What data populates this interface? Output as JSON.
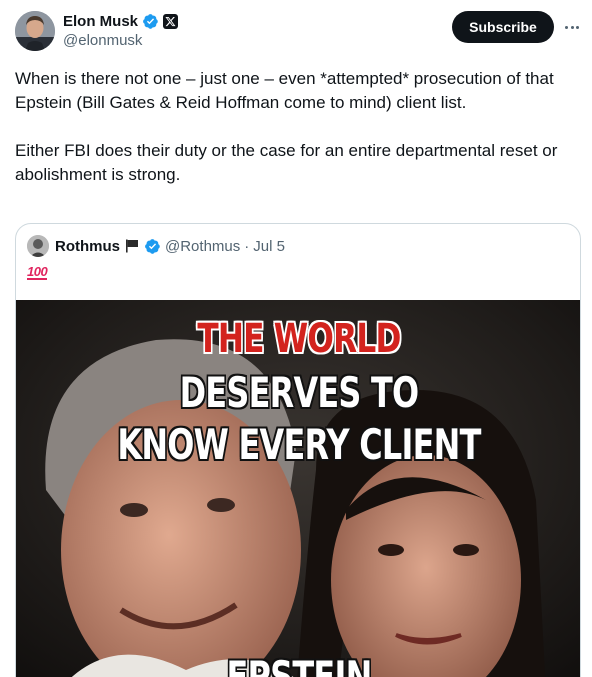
{
  "author": {
    "display_name": "Elon Musk",
    "handle": "@elonmusk",
    "verified_color": "#1d9bf0",
    "avatar_icon": "profile-photo",
    "affiliation_icon": "x-logo-icon"
  },
  "actions": {
    "subscribe_label": "Subscribe",
    "more_icon": "more-horizontal-icon"
  },
  "tweet": {
    "paragraph_1": "When is there not one – just one – even *attempted* prosecution of that Epstein (Bill Gates & Reid Hoffman come to mind) client list.",
    "paragraph_2": "Either FBI does their duty or the case for an entire departmental reset or abolishment is strong."
  },
  "quote": {
    "display_name": "Rothmus",
    "flag_icon": "black-flag-icon",
    "handle": "@Rothmus",
    "separator": "·",
    "date": "Jul 5",
    "emoji_text": "100",
    "emoji_icon": "hundred-points-emoji",
    "media": {
      "line_1": "THE WORLD",
      "line_2": "DESERVES TO",
      "line_3": "KNOW EVERY CLIENT",
      "line_4": "EPSTEIN",
      "highlight_color": "#d3231e"
    }
  }
}
